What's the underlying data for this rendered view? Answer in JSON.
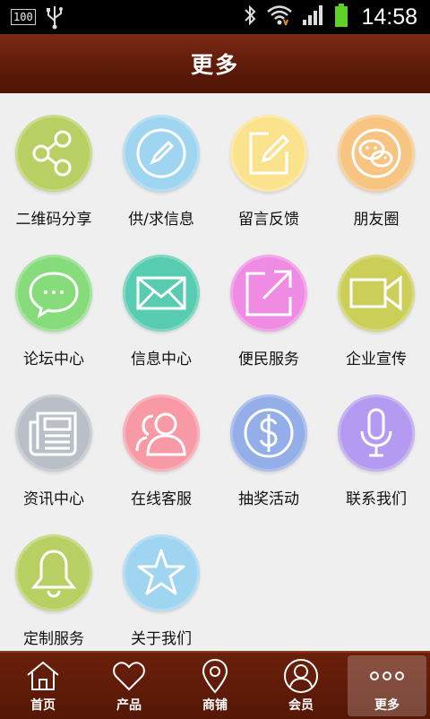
{
  "status_bar": {
    "battery_text": "100",
    "time": "14:58"
  },
  "header": {
    "title": "更多"
  },
  "grid": [
    {
      "label": "二维码分享",
      "icon": "share-icon",
      "color": "#b8cf63"
    },
    {
      "label": "供/求信息",
      "icon": "pencil-icon",
      "color": "#9fd5f1"
    },
    {
      "label": "留言反馈",
      "icon": "edit-note-icon",
      "color": "#fbe38d"
    },
    {
      "label": "朋友圈",
      "icon": "wechat-icon",
      "color": "#f7c481"
    },
    {
      "label": "论坛中心",
      "icon": "chat-bubble-icon",
      "color": "#86dc7b"
    },
    {
      "label": "信息中心",
      "icon": "envelope-icon",
      "color": "#57ccb1"
    },
    {
      "label": "便民服务",
      "icon": "external-link-icon",
      "color": "#f08be4"
    },
    {
      "label": "企业宣传",
      "icon": "video-camera-icon",
      "color": "#cbcf58"
    },
    {
      "label": "资讯中心",
      "icon": "newspaper-icon",
      "color": "#b9bfc7"
    },
    {
      "label": "在线客服",
      "icon": "users-icon",
      "color": "#f89aa6"
    },
    {
      "label": "抽奖活动",
      "icon": "dollar-coin-icon",
      "color": "#93aee8"
    },
    {
      "label": "联系我们",
      "icon": "microphone-icon",
      "color": "#b49bf1"
    },
    {
      "label": "定制服务",
      "icon": "bell-icon",
      "color": "#b8cf63"
    },
    {
      "label": "关于我们",
      "icon": "star-icon",
      "color": "#9fd5f1"
    }
  ],
  "tabs": [
    {
      "label": "首页",
      "icon": "home-icon"
    },
    {
      "label": "产品",
      "icon": "heart-icon"
    },
    {
      "label": "商铺",
      "icon": "map-pin-icon"
    },
    {
      "label": "会员",
      "icon": "user-icon"
    },
    {
      "label": "更多",
      "icon": "more-dots-icon",
      "active": true
    }
  ]
}
